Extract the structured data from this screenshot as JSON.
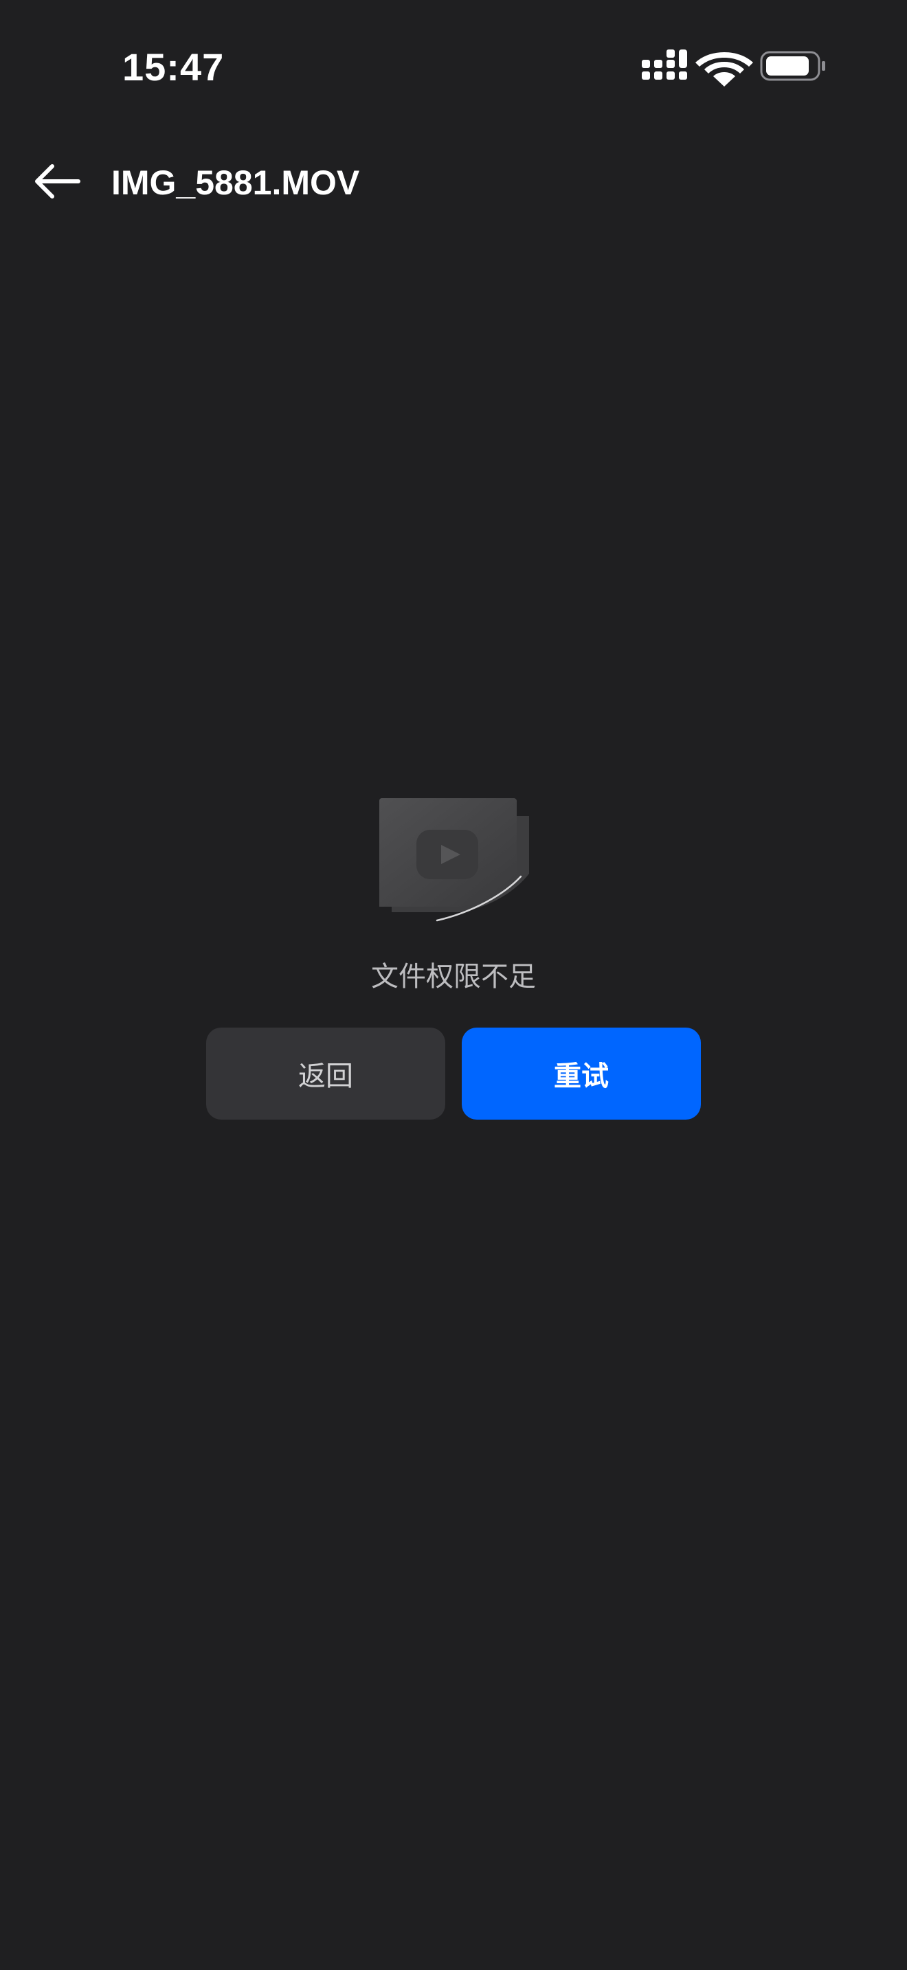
{
  "status_bar": {
    "time": "15:47",
    "icons": [
      "signal-icon",
      "wifi-icon",
      "battery-icon"
    ]
  },
  "header": {
    "back_icon": "back-arrow-icon",
    "title": "IMG_5881.MOV"
  },
  "error": {
    "icon": "video-file-error-icon",
    "message": "文件权限不足"
  },
  "actions": {
    "back_label": "返回",
    "retry_label": "重试"
  },
  "colors": {
    "background": "#1f1f21",
    "primary_button": "#0066ff",
    "secondary_button": "#343437",
    "message_text": "#bdbdc0"
  }
}
